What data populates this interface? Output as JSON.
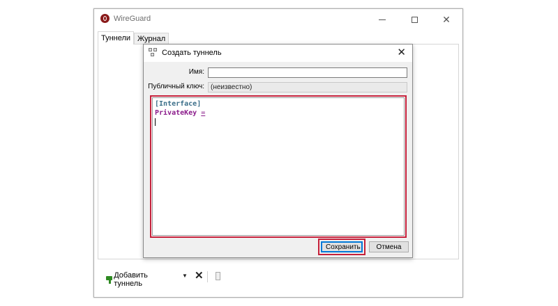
{
  "app": {
    "title": "WireGuard",
    "tabs": [
      {
        "label": "Туннели",
        "active": true
      },
      {
        "label": "Журнал",
        "active": false
      }
    ]
  },
  "toolbar": {
    "add_tunnel_label": "Добавить туннель",
    "icons": [
      "add-tunnel-icon",
      "chevron-down-icon",
      "delete-icon",
      "export-icon"
    ]
  },
  "dialog": {
    "title": "Создать туннель",
    "name_label": "Имя:",
    "name_value": "",
    "public_key_label": "Публичный ключ:",
    "public_key_value": "(неизвестно)",
    "config_lines": {
      "section": "[Interface]",
      "key": "PrivateKey",
      "equals": "="
    },
    "save_label": "Сохранить",
    "cancel_label": "Отмена"
  },
  "colors": {
    "highlight": "#c5203a",
    "section_color": "#3c6f8a",
    "key_color": "#8b1c8b",
    "focus_blue": "#0078d7"
  }
}
